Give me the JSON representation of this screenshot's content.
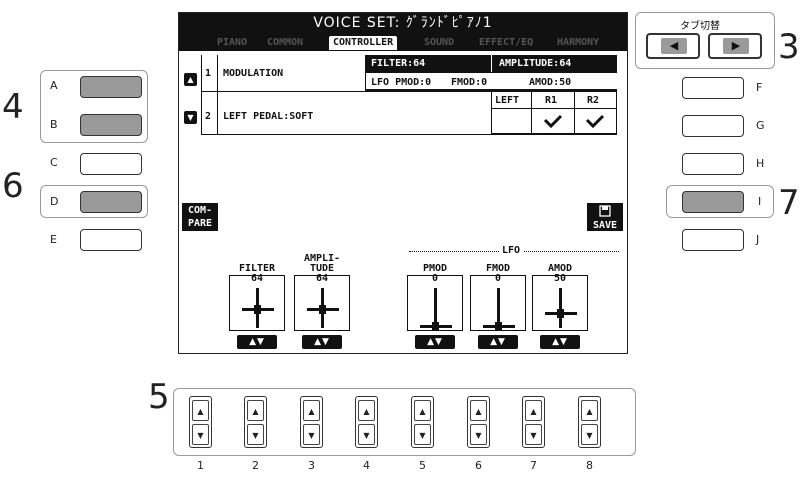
{
  "screen": {
    "title": "VOICE SET: ｸﾞﾗﾝﾄﾞﾋﾟｱﾉ1",
    "tabs": [
      "PIANO",
      "COMMON",
      "CONTROLLER",
      "SOUND",
      "EFFECT/EQ",
      "HARMONY"
    ],
    "active_tab": "CONTROLLER",
    "row1": {
      "num": "1",
      "name": "MODULATION",
      "filter": "FILTER:64",
      "amplitude": "AMPLITUDE:64",
      "lfo_pmod": "LFO PMOD:0",
      "fmod": "FMOD:0",
      "amod": "AMOD:50"
    },
    "row2": {
      "num": "2",
      "name": "LEFT PEDAL:SOFT",
      "col_left": "LEFT",
      "col_r1": "R1",
      "col_r2": "R2",
      "left_checked": false,
      "r1_checked": true,
      "r2_checked": true
    },
    "compare_line1": "COM-",
    "compare_line2": "PARE",
    "save_label": "SAVE",
    "lfo_label": "LFO",
    "sliders": [
      {
        "label1": "",
        "label2": "FILTER",
        "value": "64",
        "level": 0.5
      },
      {
        "label1": "AMPLI-",
        "label2": "TUDE",
        "value": "64",
        "level": 0.5
      },
      {
        "label1": "",
        "label2": "PMOD",
        "value": "0",
        "level": 0.0
      },
      {
        "label1": "",
        "label2": "FMOD",
        "value": "0",
        "level": 0.0
      },
      {
        "label1": "",
        "label2": "AMOD",
        "value": "50",
        "level": 0.39
      }
    ]
  },
  "tab_switch": {
    "label": "タブ切替",
    "left": "◀",
    "right": "▶"
  },
  "left_buttons": [
    "A",
    "B",
    "C",
    "D",
    "E"
  ],
  "right_buttons": [
    "F",
    "G",
    "H",
    "I",
    "J"
  ],
  "callouts": {
    "n3": "3",
    "n4": "4",
    "n5": "5",
    "n6": "6",
    "n7": "7"
  },
  "bottom_buttons": [
    "1",
    "2",
    "3",
    "4",
    "5",
    "6",
    "7",
    "8"
  ],
  "glyphs": {
    "up": "▲",
    "down": "▼",
    "updown": "▲▼"
  }
}
